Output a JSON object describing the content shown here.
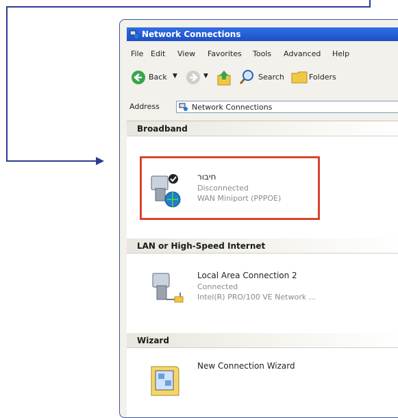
{
  "window": {
    "title": "Network Connections",
    "menu": [
      "File",
      "Edit",
      "View",
      "Favorites",
      "Tools",
      "Advanced",
      "Help"
    ],
    "toolbar": {
      "back": "Back",
      "search": "Search",
      "folders": "Folders"
    },
    "address": {
      "label": "Address",
      "value": "Network Connections"
    }
  },
  "groups": [
    {
      "title": "Broadband",
      "items": [
        {
          "name": "חיבור",
          "status": "Disconnected",
          "device": "WAN Miniport (PPPOE)",
          "highlighted": true
        }
      ]
    },
    {
      "title": "LAN or High-Speed Internet",
      "items": [
        {
          "name": "Local Area Connection 2",
          "status": "Connected",
          "device": "Intel(R) PRO/100 VE Network ..."
        }
      ]
    },
    {
      "title": "Wizard",
      "items": [
        {
          "name": "New Connection Wizard"
        }
      ]
    }
  ],
  "colors": {
    "accent_line": "#2b3d8f",
    "highlight": "#d9432c",
    "titlebar": "#2f6fe8"
  }
}
